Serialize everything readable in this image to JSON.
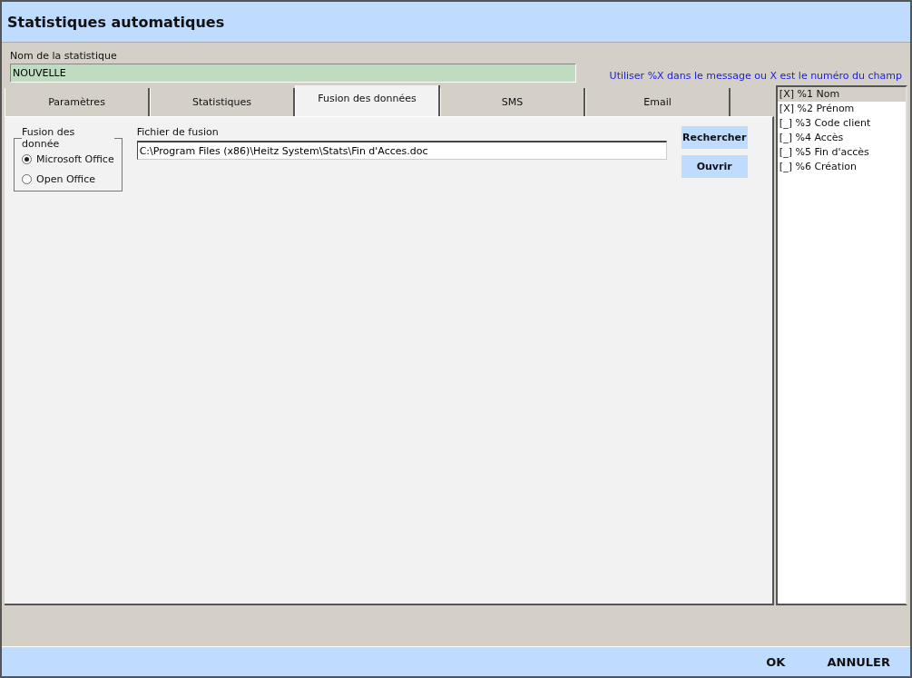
{
  "window": {
    "title": "Statistiques automatiques"
  },
  "name_field": {
    "label": "Nom de la statistique",
    "value": "NOUVELLE"
  },
  "hint": "Utiliser %X dans le message ou X est le numéro du champ",
  "tabs": [
    {
      "label": "Paramètres",
      "selected": false
    },
    {
      "label": "Statistiques",
      "selected": false
    },
    {
      "label": "Fusion des données",
      "selected": true
    },
    {
      "label": "SMS",
      "selected": false
    },
    {
      "label": "Email",
      "selected": false
    }
  ],
  "merge_group": {
    "legend": "Fusion des donnée",
    "options": [
      {
        "label": "Microsoft Office",
        "selected": true
      },
      {
        "label": "Open Office",
        "selected": false
      }
    ]
  },
  "merge_file": {
    "label": "Fichier de fusion",
    "value": "C:\\Program Files (x86)\\Heitz System\\Stats\\Fin d'Acces.doc"
  },
  "side_buttons": [
    "Rechercher",
    "Ouvrir"
  ],
  "fields": [
    {
      "label": "[X] %1 Nom",
      "selected": true
    },
    {
      "label": "[X] %2 Prénom",
      "selected": false
    },
    {
      "label": "[_] %3 Code client",
      "selected": false
    },
    {
      "label": "[_] %4 Accès",
      "selected": false
    },
    {
      "label": "[_] %5 Fin d'accès",
      "selected": false
    },
    {
      "label": "[_] %6 Création",
      "selected": false
    }
  ],
  "footer_buttons": [
    "OK",
    "ANNULER"
  ]
}
